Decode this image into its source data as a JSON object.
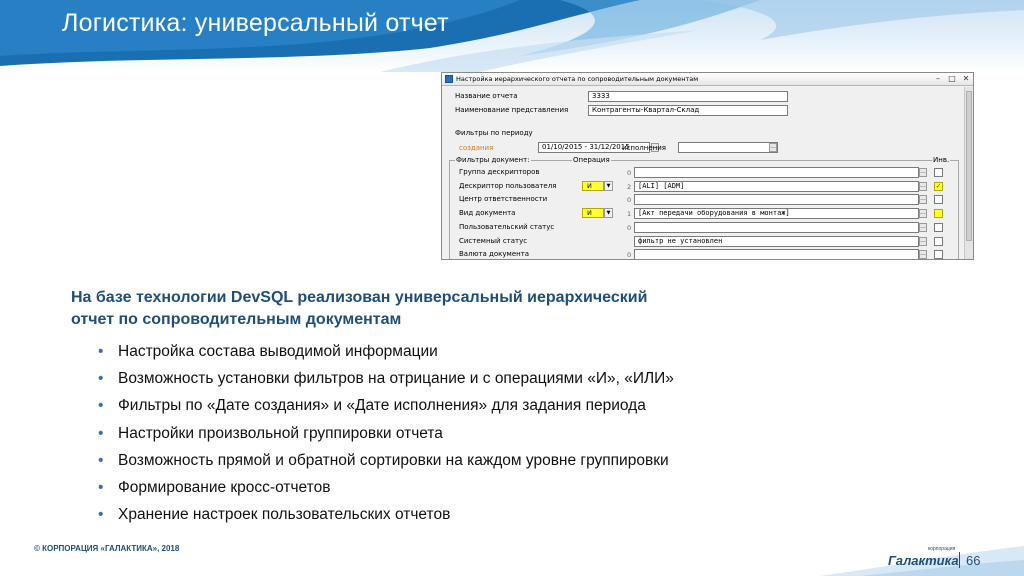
{
  "slide": {
    "title": "Логистика: универсальный отчет",
    "subtitle_line1": "На базе технологии DevSQL реализован универсальный иерархический",
    "subtitle_line2": "отчет по сопроводительным документам",
    "bullets": [
      "Настройка состава выводимой информации",
      "Возможность установки фильтров на отрицание и с операциями «И», «ИЛИ»",
      "Фильтры по «Дате создания» и «Дате исполнения» для задания периода",
      "Настройки произвольной группировки отчета",
      "Возможность прямой и обратной сортировки на каждом уровне группировки",
      "Формирование кросс-отчетов",
      "Хранение настроек пользовательских отчетов"
    ],
    "bullet_char": "•",
    "footer_copyright": "© КОРПОРАЦИЯ «ГАЛАКТИКА», 2018",
    "logo_text": "Галактика",
    "logo_subtext": "корпорация",
    "page_number": "66"
  },
  "app": {
    "window_title": "Настройка иерархического отчета по сопроводительным документам",
    "title_buttons": {
      "minimize": "–",
      "maximize": "□",
      "close": "✕"
    },
    "report_name_label": "Название отчета",
    "report_name_value": "3333",
    "view_name_label": "Наименование представления",
    "view_name_value": "Контрагенты-Квартал-Склад",
    "period_group_label": "Фильтры по периоду",
    "created_label": "создания",
    "created_value": "01/10/2015 - 31/12/2015",
    "executed_label": "исполнения",
    "executed_value": "",
    "doc_filters_label": "Фильтры документ:",
    "operation_header": "Операция",
    "inv_header": "Инв.",
    "filters": [
      {
        "label": "Группа дескрипторов",
        "op": "",
        "count": "0",
        "value": "",
        "checked": false,
        "highlight": false
      },
      {
        "label": "Дескриптор пользователя",
        "op": "И",
        "count": "2",
        "value": "[ALI] [ADM]",
        "checked": true,
        "highlight": true
      },
      {
        "label": "Центр ответственности",
        "op": "",
        "count": "0",
        "value": "",
        "checked": false,
        "highlight": false
      },
      {
        "label": "Вид документа",
        "op": "И",
        "count": "1",
        "value": "[Акт передачи оборудования в монтаж]",
        "checked": false,
        "highlight": true
      },
      {
        "label": "Пользовательский статус",
        "op": "",
        "count": "0",
        "value": "",
        "checked": false,
        "highlight": false
      },
      {
        "label": "Системный статус",
        "op": "",
        "count": "",
        "value": "фильтр не установлен",
        "checked": false,
        "highlight": false
      },
      {
        "label": "Валюта документа",
        "op": "",
        "count": "0",
        "value": "",
        "checked": false,
        "highlight": false
      }
    ],
    "ellipsis": "...",
    "checkmark": "✓",
    "dropdown_arrow": "▼"
  },
  "colors": {
    "title_text": "#ffffff",
    "banner_blue": "#1a6fb3",
    "subtitle_text": "#1f4e79",
    "bullet_dot": "#3b6fb0",
    "highlight_yellow": "#ffff33",
    "orange_label": "#d07a1a"
  }
}
